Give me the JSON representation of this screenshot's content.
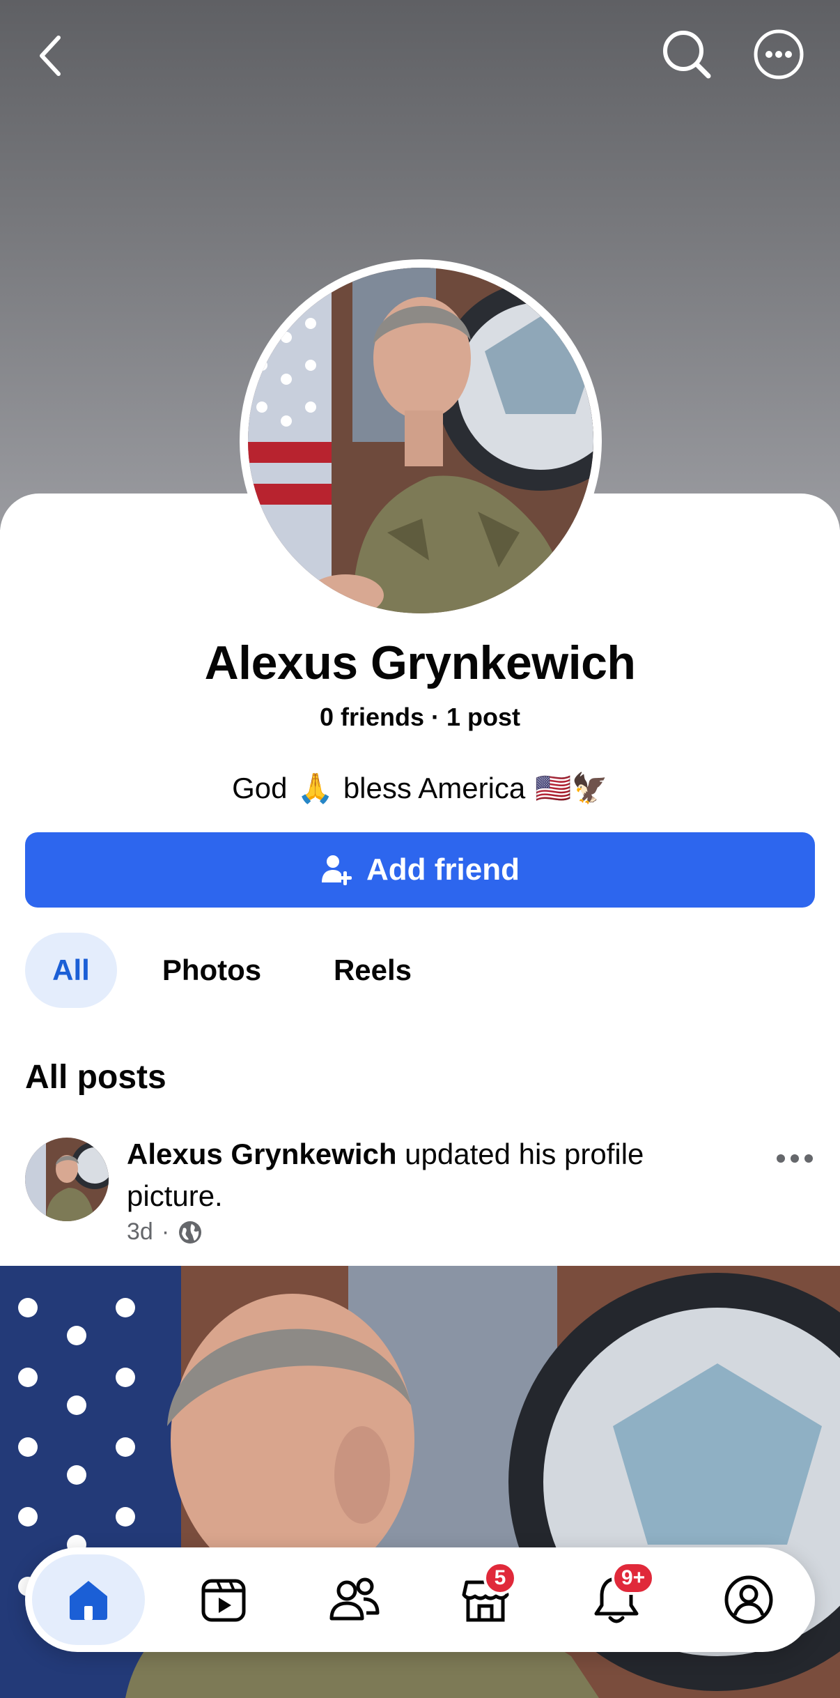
{
  "profile": {
    "name": "Alexus Grynkewich",
    "stats": "0 friends · 1 post",
    "bio": {
      "before": "God",
      "emoji1": "🙏",
      "middle": "bless America",
      "emoji2": "🇺🇸🦅"
    }
  },
  "actions": {
    "add_friend_label": "Add friend"
  },
  "tabs": [
    {
      "label": "All",
      "active": true
    },
    {
      "label": "Photos",
      "active": false
    },
    {
      "label": "Reels",
      "active": false
    }
  ],
  "posts_section": {
    "title": "All posts"
  },
  "post": {
    "author": "Alexus Grynkewich",
    "action_text": " updated his profile picture.",
    "time": "3d",
    "separator": "·",
    "audience_icon": "globe-icon"
  },
  "bottom_nav": {
    "items": [
      {
        "name": "home",
        "icon": "home-icon",
        "active": true
      },
      {
        "name": "video",
        "icon": "video-icon",
        "active": false
      },
      {
        "name": "friends",
        "icon": "friends-icon",
        "active": false
      },
      {
        "name": "marketplace",
        "icon": "marketplace-icon",
        "badge": "5"
      },
      {
        "name": "notifications",
        "icon": "bell-icon",
        "badge": "9+"
      },
      {
        "name": "profile",
        "icon": "profile-icon",
        "active": false
      }
    ]
  },
  "colors": {
    "accent": "#2d66ee",
    "badge": "#e0293a",
    "chip_active_bg": "#e4edfc",
    "chip_active_text": "#1b5fd6"
  }
}
